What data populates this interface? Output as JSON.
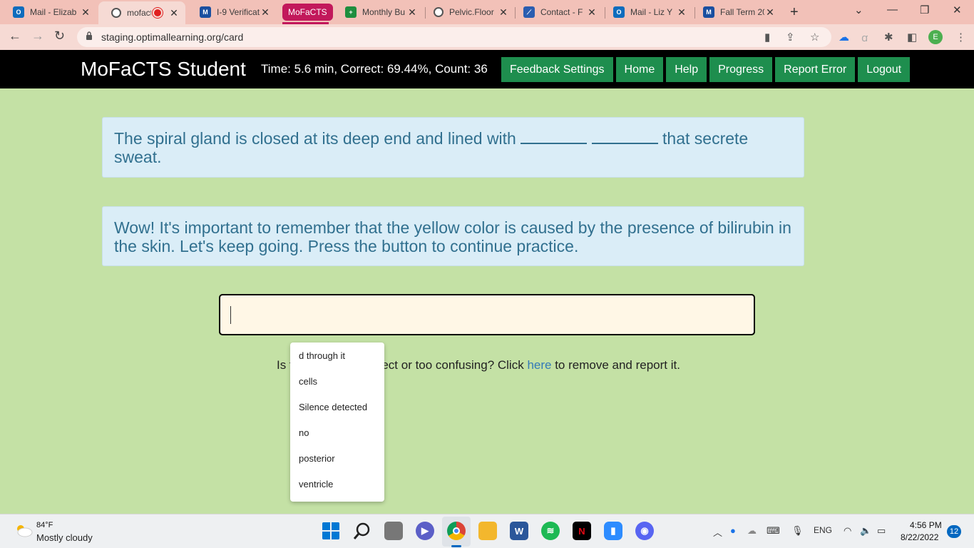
{
  "browser": {
    "tabs": [
      {
        "title": "Mail - Elizab",
        "favicon": "outlook-icon",
        "color": "#0f6cbd"
      },
      {
        "title": "mofact",
        "favicon": "chrome-page-icon",
        "color": "#555555",
        "recording": true
      },
      {
        "title": "I-9 Verificat",
        "favicon": "doc-icon",
        "color": "#1a4fa0"
      },
      {
        "title": "Monthly Bu",
        "favicon": "sheets-icon",
        "color": "#1e8e3e"
      },
      {
        "title": "Pelvic.Floor",
        "favicon": "globe-icon",
        "color": "#555555"
      },
      {
        "title": "Contact - F",
        "favicon": "site-icon",
        "color": "#2a5db0"
      },
      {
        "title": "Mail - Liz Y",
        "favicon": "outlook-icon",
        "color": "#0f6cbd"
      },
      {
        "title": "Fall Term 20",
        "favicon": "doc-icon",
        "color": "#1a4fa0"
      }
    ],
    "tab_group_label": "MoFaCTS",
    "url": "staging.optimallearning.org/card",
    "profile_initial": "E"
  },
  "app": {
    "brand": "MoFaCTS Student",
    "stats": "Time: 5.6 min, Correct: 69.44%, Count: 36",
    "nav": [
      "Feedback Settings",
      "Home",
      "Help",
      "Progress",
      "Report Error",
      "Logout"
    ]
  },
  "question": {
    "before": "The spiral gland is closed at its deep end and lined with",
    "after": "that secrete sweat."
  },
  "feedback": "Wow! It's important to remember that the yellow color is caused by the presence of bilirubin in the skin. Let's keep going. Press the button to continue practice.",
  "answer": {
    "value": ""
  },
  "report": {
    "prefix": "Is t",
    "middle": "rect or too confusing? Click ",
    "link": "here",
    "suffix": " to remove and report it."
  },
  "autocomplete": [
    "d through it",
    "cells",
    "Silence detected",
    "no",
    "posterior",
    "ventricle"
  ],
  "taskbar": {
    "temperature": "84°F",
    "weather": "Mostly cloudy",
    "language": "ENG",
    "time": "4:56 PM",
    "date": "8/22/2022",
    "notifications": "12"
  }
}
